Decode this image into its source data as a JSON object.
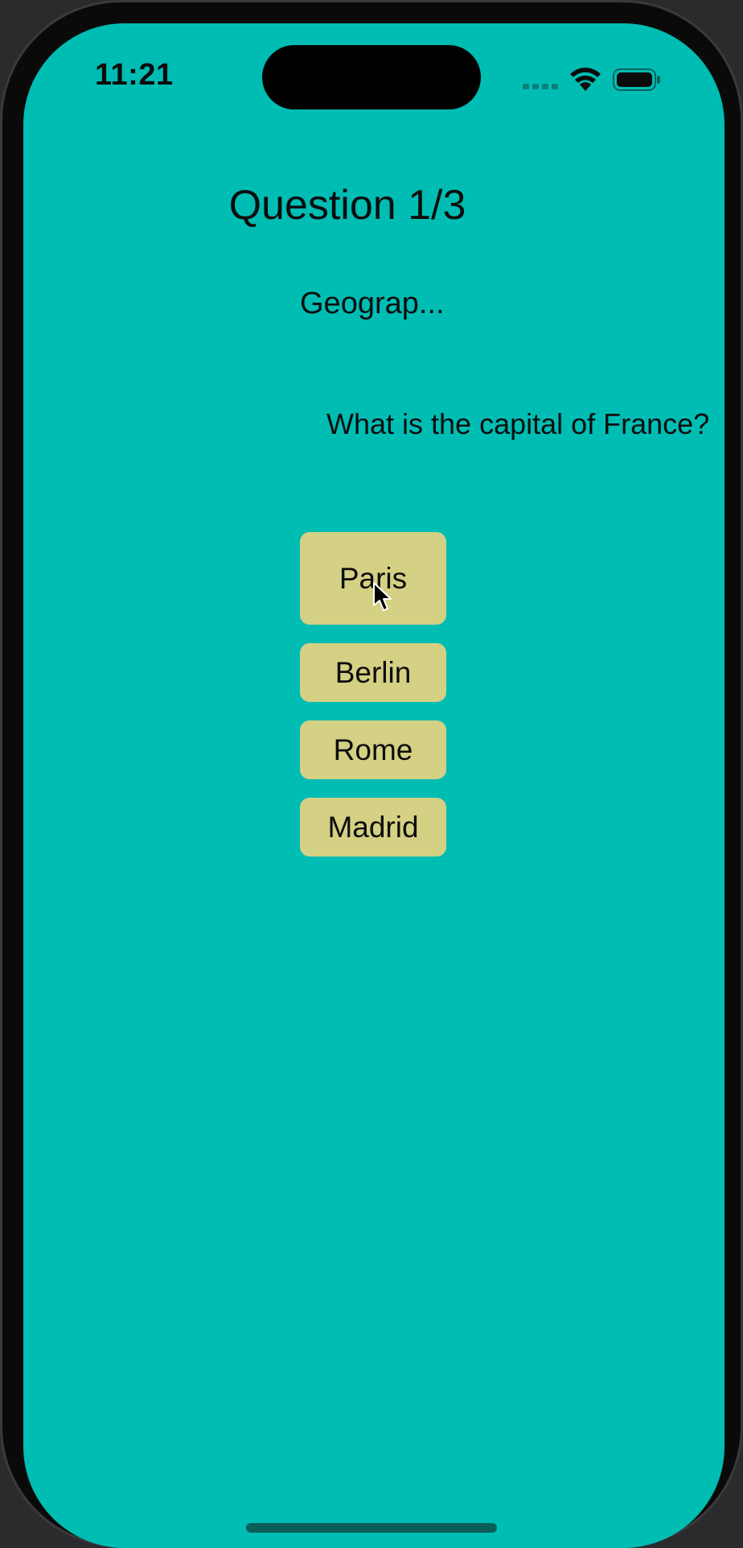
{
  "status_bar": {
    "time": "11:21",
    "icons": [
      "cellular-signal-icon",
      "wifi-icon",
      "battery-icon"
    ]
  },
  "quiz": {
    "title": "Question 1/3",
    "category": "Geograp...",
    "question": "What is the capital of France?",
    "answers": [
      {
        "label": "Paris"
      },
      {
        "label": "Berlin"
      },
      {
        "label": "Rome"
      },
      {
        "label": "Madrid"
      }
    ]
  },
  "colors": {
    "background": "#00bdb4",
    "answer_button": "#d4d084",
    "text": "#0d0d0d"
  }
}
